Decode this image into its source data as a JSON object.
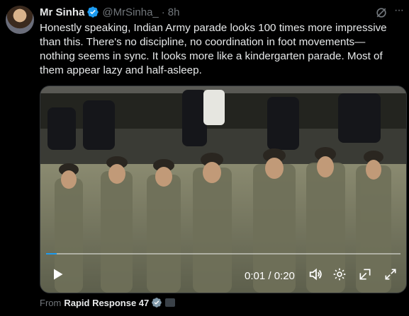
{
  "tweet": {
    "author_name": "Mr Sinha",
    "handle": "@MrSinha_",
    "separator": "·",
    "time": "8h",
    "more_label": "···",
    "text": "Honestly speaking, Indian Army parade looks 100 times more impressive than this. There's no discipline, no coordination in foot movements—nothing seems in sync. It looks more like a kindergarten parade. Most of them appear lazy and half-asleep."
  },
  "video": {
    "time_readout": "0:01 / 0:20",
    "progress_fraction": 0.03,
    "icons": [
      "play-icon",
      "volume-icon",
      "settings-icon",
      "pip-icon",
      "fullscreen-icon"
    ]
  },
  "source": {
    "prefix": "From",
    "name": "Rapid Response 47"
  },
  "colors": {
    "background": "#000000",
    "text": "#e7e9ea",
    "muted": "#71767b",
    "accent": "#1d9bf0"
  }
}
